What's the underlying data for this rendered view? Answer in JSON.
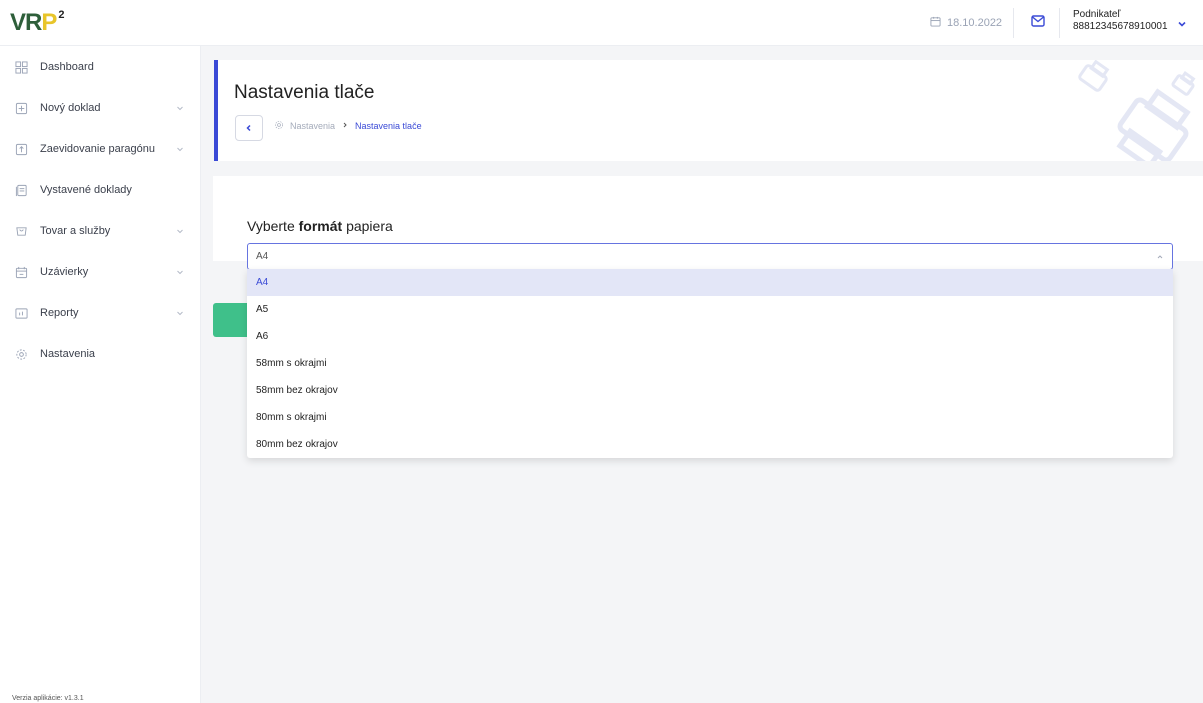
{
  "topbar": {
    "logo_main": "VRP",
    "logo_sup": "2",
    "date": "18.10.2022",
    "user_role": "Podnikateľ",
    "user_id": "88812345678910001"
  },
  "sidebar": {
    "items": [
      {
        "label": "Dashboard",
        "icon": "dashboard-icon",
        "has_chevron": false
      },
      {
        "label": "Nový doklad",
        "icon": "add-document-icon",
        "has_chevron": true
      },
      {
        "label": "Zaevidovanie paragónu",
        "icon": "upload-document-icon",
        "has_chevron": true
      },
      {
        "label": "Vystavené doklady",
        "icon": "documents-icon",
        "has_chevron": false
      },
      {
        "label": "Tovar a služby",
        "icon": "cart-icon",
        "has_chevron": true
      },
      {
        "label": "Uzávierky",
        "icon": "calendar-check-icon",
        "has_chevron": true
      },
      {
        "label": "Reporty",
        "icon": "report-icon",
        "has_chevron": true
      },
      {
        "label": "Nastavenia",
        "icon": "gear-icon",
        "has_chevron": false
      }
    ],
    "version": "Verzia aplikácie: v1.3.1"
  },
  "header": {
    "title": "Nastavenia tlače",
    "breadcrumb": [
      {
        "label": "Nastavenia"
      },
      {
        "label": "Nastavenia tlače"
      }
    ]
  },
  "form": {
    "label_prefix": "Vyberte ",
    "label_bold": "formát",
    "label_suffix": " papiera",
    "selected": "A4",
    "options": [
      "A4",
      "A5",
      "A6",
      "58mm s okrajmi",
      "58mm bez okrajov",
      "80mm s okrajmi",
      "80mm bez okrajov"
    ]
  },
  "colors": {
    "accent": "#3a4ad6",
    "green": "#3fc08a",
    "logo_green": "#2e5f3a",
    "logo_yellow": "#e8c52a"
  }
}
